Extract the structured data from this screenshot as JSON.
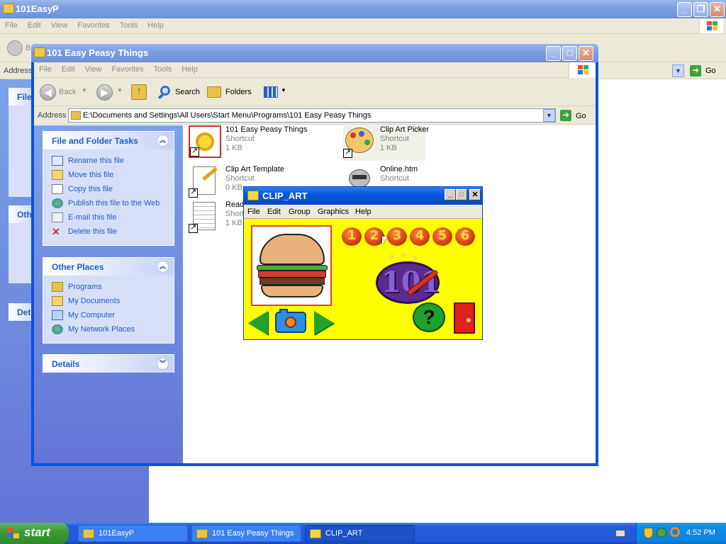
{
  "back_window": {
    "title": "101EasyP",
    "menu": [
      "File",
      "Edit",
      "View",
      "Favorites",
      "Tools",
      "Help"
    ],
    "address_label": "Address",
    "go_label": "Go",
    "back_letter": "B",
    "side_heads": [
      "File",
      "Oth",
      "Det"
    ]
  },
  "explorer": {
    "title": "101 Easy Peasy Things",
    "menu": [
      "File",
      "Edit",
      "View",
      "Favorites",
      "Tools",
      "Help"
    ],
    "toolbar": {
      "back": "Back",
      "search": "Search",
      "folders": "Folders"
    },
    "address_label": "Address",
    "address_value": "E:\\Documents and Settings\\All Users\\Start Menu\\Programs\\101 Easy Peasy Things",
    "go_label": "Go",
    "tasks": {
      "file_folder": {
        "title": "File and Folder Tasks",
        "items": [
          "Rename this file",
          "Move this file",
          "Copy this file",
          "Publish this file to the Web",
          "E-mail this file",
          "Delete this file"
        ]
      },
      "other_places": {
        "title": "Other Places",
        "items": [
          "Programs",
          "My Documents",
          "My Computer",
          "My Network Places"
        ]
      },
      "details": {
        "title": "Details"
      }
    },
    "files": [
      {
        "name": "101 Easy Peasy Things",
        "type": "Shortcut",
        "size": "1 KB",
        "icon": "app-101-icon"
      },
      {
        "name": "Clip Art Picker",
        "type": "Shortcut",
        "size": "1 KB",
        "icon": "palette-icon"
      },
      {
        "name": "Clip Art Template",
        "type": "Shortcut",
        "size": "0 KB",
        "icon": "paint-doc-icon"
      },
      {
        "name": "Online.htm",
        "type": "Shortcut",
        "size": "",
        "icon": "raccoon-icon"
      },
      {
        "name": "Read",
        "type": "Shortcut",
        "size": "1 KB",
        "icon": "notepad-icon"
      }
    ]
  },
  "clip_art": {
    "title": "CLIP_ART",
    "menu": [
      "File",
      "Edit",
      "Group",
      "Graphics",
      "Help"
    ],
    "numbers": [
      "1",
      "2",
      "3",
      "4",
      "5",
      "6"
    ],
    "logo_text": "101",
    "help_mark": "?",
    "colors": {
      "background": "#ffff00",
      "number_button": "#e0520f",
      "frame": "#e3401c"
    }
  },
  "taskbar": {
    "start_label": "start",
    "tasks": [
      {
        "label": "101EasyP"
      },
      {
        "label": "101 Easy Peasy Things"
      },
      {
        "label": "CLIP_ART"
      }
    ],
    "clock": "4:52 PM"
  }
}
